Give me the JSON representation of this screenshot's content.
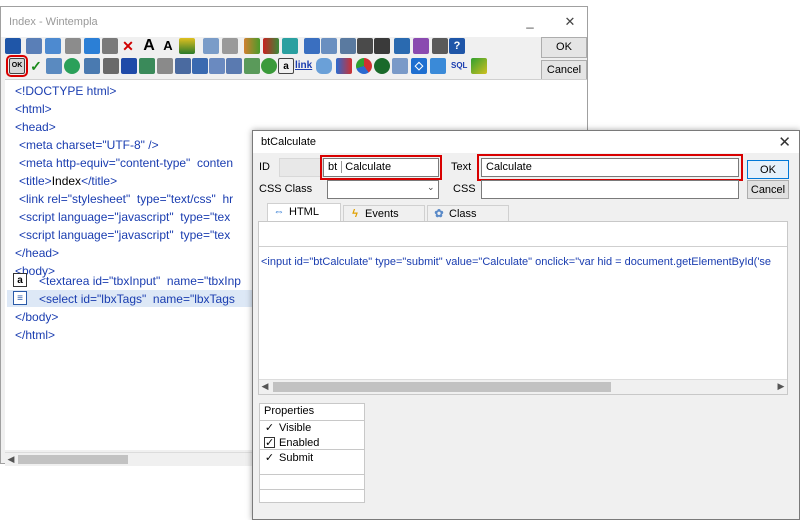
{
  "main_window": {
    "title": "Index - Wintempla",
    "ok_label": "OK",
    "cancel_label": "Cancel"
  },
  "editor_lines": [
    {
      "tag": "<!DOCTYPE html>"
    },
    {
      "tag": "<html>"
    },
    {
      "tag": "<head>"
    },
    {
      "tag": "<meta ",
      "attrs": "charset=\"UTF-8\" />"
    },
    {
      "tag": "<meta ",
      "attrs": "http-equiv=\"content-type\"  conten"
    },
    {
      "tag": "<title>",
      "text": "Index",
      "close": "</title>"
    },
    {
      "tag": "<link ",
      "attrs": "rel=\"stylesheet\"  type=\"text/css\"  hr"
    },
    {
      "tag": "<script ",
      "attrs": "language=\"javascript\"  type=\"tex"
    },
    {
      "tag": "<script ",
      "attrs": "language=\"javascript\"  type=\"tex"
    },
    {
      "tag": "</head>"
    },
    {
      "tag": "<body>"
    },
    {
      "tag": "<textarea ",
      "attrs": "id=\"tbxInput\"  name=\"tbxInp"
    },
    {
      "tag": "<select ",
      "attrs": "id=\"lbxTags\"  name=\"lbxTags"
    },
    {
      "tag": "</body>"
    },
    {
      "tag": "</html>"
    }
  ],
  "dialog": {
    "title": "btCalculate",
    "id_label": "ID",
    "id_prefix": "bt",
    "id_value": "Calculate",
    "text_label": "Text",
    "text_value": "Calculate",
    "css_class_label": "CSS Class",
    "css_label": "CSS",
    "ok_label": "OK",
    "cancel_label": "Cancel",
    "tabs": [
      {
        "label": "HTML",
        "icon": "html-icon"
      },
      {
        "label": "Events",
        "icon": "lightning-icon"
      },
      {
        "label": "Class",
        "icon": "class-icon"
      }
    ],
    "html_code": "<input id=\"btCalculate\" type=\"submit\" value=\"Calculate\" onclick=\"var hid = document.getElementById('se",
    "properties_header": "Properties",
    "properties": [
      {
        "label": "Visible",
        "checked": true
      },
      {
        "label": "Enabled",
        "checked": true
      },
      {
        "label": "Submit",
        "checked": true
      }
    ]
  },
  "colors": {
    "highlight_red": "#d80000",
    "code_blue": "#1a3db0",
    "focus_blue": "#0078d7"
  }
}
